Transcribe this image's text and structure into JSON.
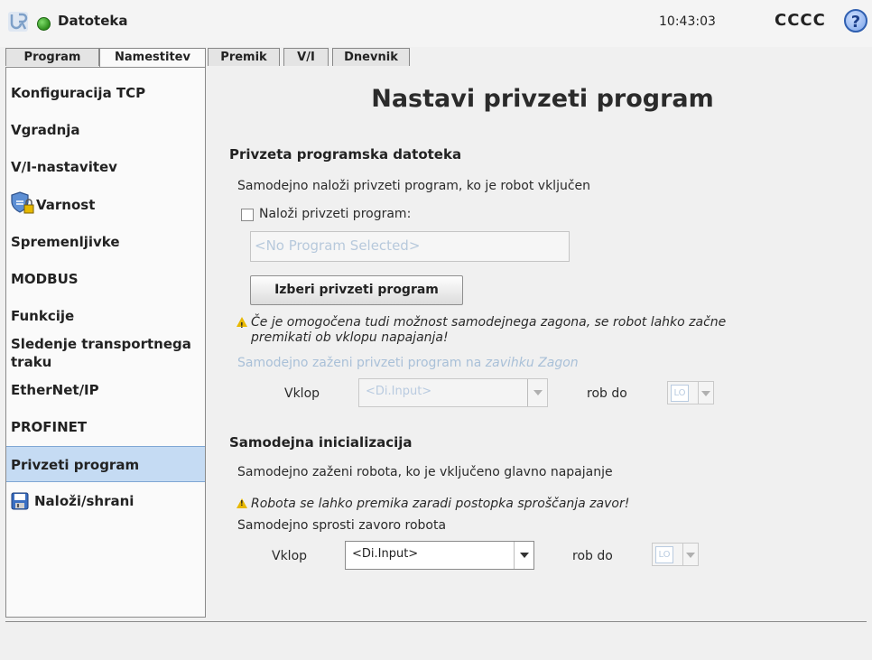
{
  "topbar": {
    "file_menu": "Datoteka",
    "clock": "10:43:03",
    "robot_name": "CCCC",
    "help_symbol": "?"
  },
  "tabs": [
    {
      "label": "Program"
    },
    {
      "label": "Namestitev"
    }
  ],
  "subtabs": [
    {
      "label": "Premik"
    },
    {
      "label": "V/I"
    },
    {
      "label": "Dnevnik"
    }
  ],
  "sidebar": {
    "items": [
      {
        "label": "Konfiguracija TCP"
      },
      {
        "label": "Vgradnja"
      },
      {
        "label": "V/I-nastavitev"
      },
      {
        "label": "Varnost"
      },
      {
        "label": "Spremenljivke"
      },
      {
        "label": "MODBUS"
      },
      {
        "label": "Funkcije"
      },
      {
        "label": "Sledenje transportnega traku"
      },
      {
        "label": "EtherNet/IP"
      },
      {
        "label": "PROFINET"
      },
      {
        "label": "Privzeti program"
      },
      {
        "label": "Naloži/shrani"
      }
    ]
  },
  "main": {
    "title": "Nastavi privzeti program",
    "default_file": {
      "section_title": "Privzeta programska datoteka",
      "description": "Samodejno naloži privzeti program, ko je robot vključen",
      "load_checkbox_label": "Naloži privzeti program:",
      "program_field_placeholder": "<No Program Selected>",
      "select_button": "Izberi privzeti program",
      "warning_line1": "Če je omogočena tudi možnost samodejnega zagona, se robot lahko začne",
      "warning_line2": "premikati ob vklopu napajanja!",
      "autostart_text": "Samodejno zaženi privzeti program na ",
      "autostart_link": "zavihku Zagon",
      "power_label": "Vklop",
      "input_combo": "<Di.Input>",
      "edge_label": "rob do",
      "level_value": "LO"
    },
    "auto_init": {
      "section_title": "Samodejna inicializacija",
      "description": "Samodejno zaženi robota, ko je vključeno glavno napajanje",
      "warning": "Robota se lahko premika zaradi postopka sproščanja zavor!",
      "release_text": "Samodejno sprosti zavoro robota",
      "power_label": "Vklop",
      "input_combo": "<Di.Input>",
      "edge_label": "rob do",
      "level_value": "LO"
    }
  }
}
